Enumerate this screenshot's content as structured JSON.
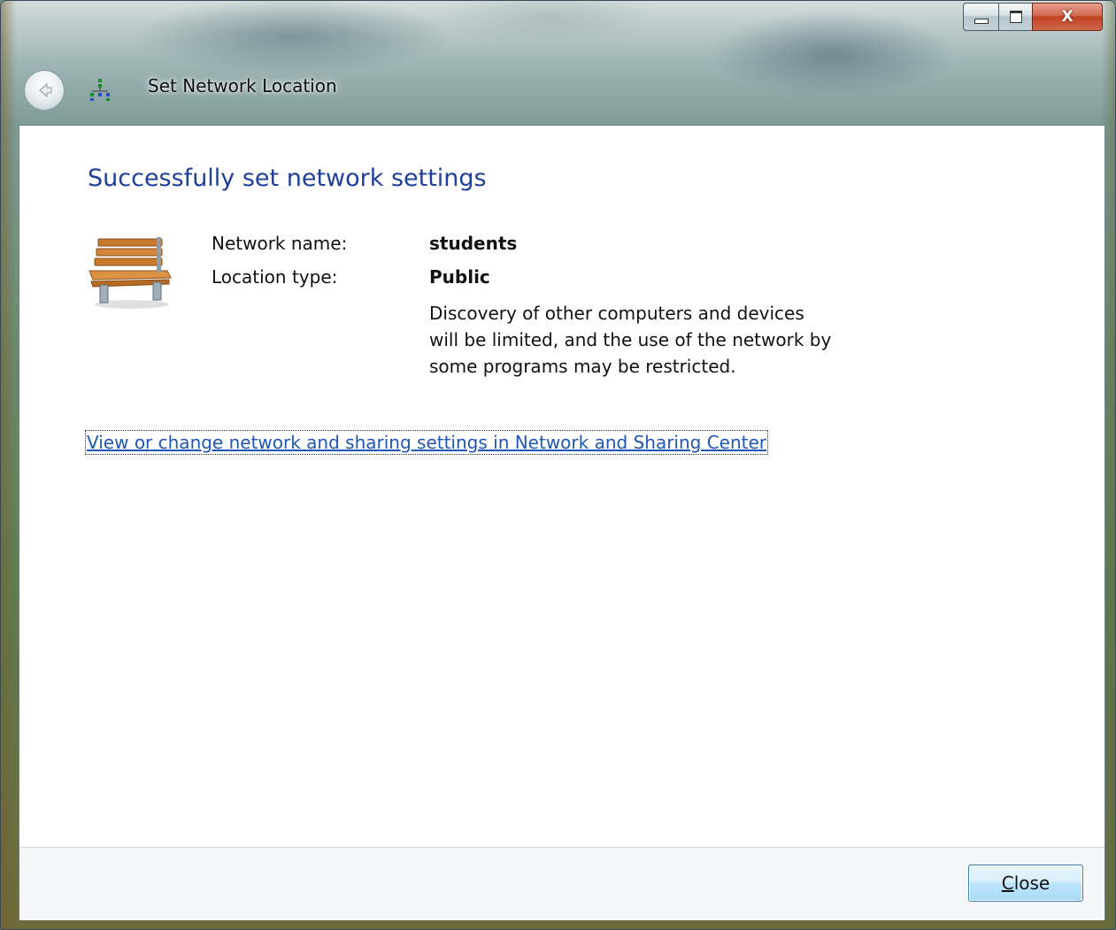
{
  "window": {
    "title": "Set Network Location",
    "close_glyph": "X"
  },
  "icons": {
    "back": "back-arrow-icon",
    "network": "network-icon",
    "location": "park-bench-icon"
  },
  "content": {
    "heading": "Successfully set network settings",
    "network_name_label": "Network name:",
    "network_name_value": "students",
    "location_type_label": "Location type:",
    "location_type_value": "Public",
    "description": "Discovery of other computers and devices will be limited, and the use of the network by some programs may be restricted.",
    "link": "View or change network and sharing settings in Network and Sharing Center"
  },
  "footer": {
    "close_mnemonic": "C",
    "close_rest": "lose"
  },
  "colors": {
    "heading": "#1e3f9a",
    "link": "#1f57b8"
  }
}
